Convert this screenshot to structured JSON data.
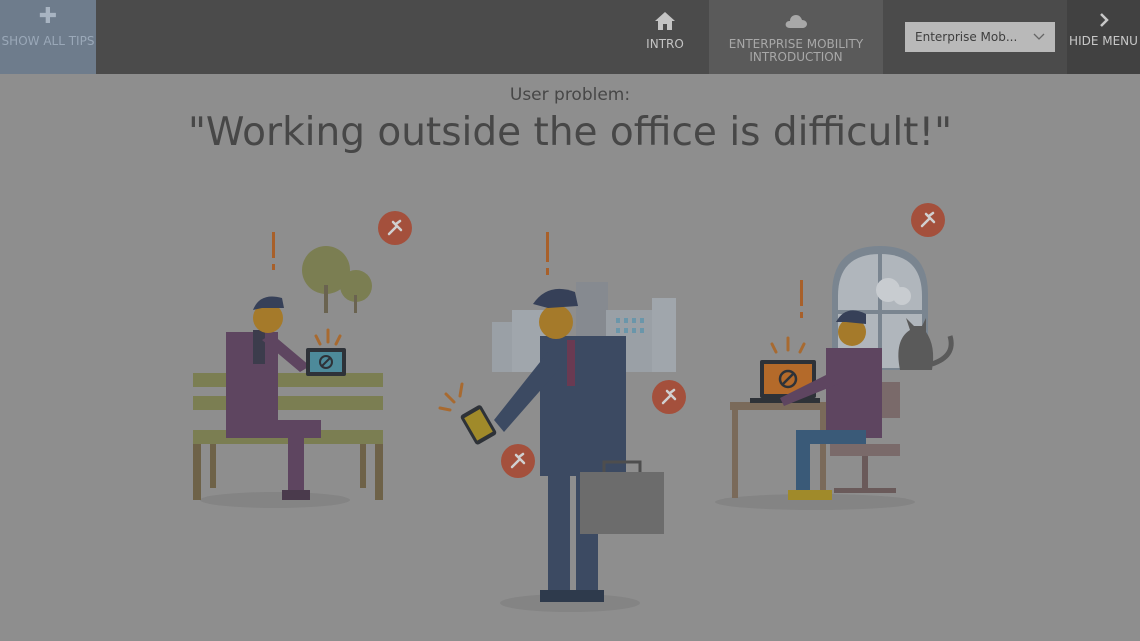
{
  "topbar": {
    "show_tips_label": "SHOW ALL TIPS",
    "nav": [
      {
        "label": "INTRO",
        "icon": "home-icon"
      },
      {
        "label": "ENTERPRISE MOBILITY INTRODUCTION",
        "icon": "cloud-icon"
      }
    ],
    "scenario_select": {
      "value": "Enterprise Mob..."
    },
    "hide_menu_label": "HIDE MENU"
  },
  "content": {
    "subtitle": "User problem:",
    "headline": "\"Working outside the office is difficult!\""
  },
  "colors": {
    "overlay_bg": "#8e8e8e",
    "accent_pin": "#a4503c",
    "device_screen": "#b46a2a"
  }
}
